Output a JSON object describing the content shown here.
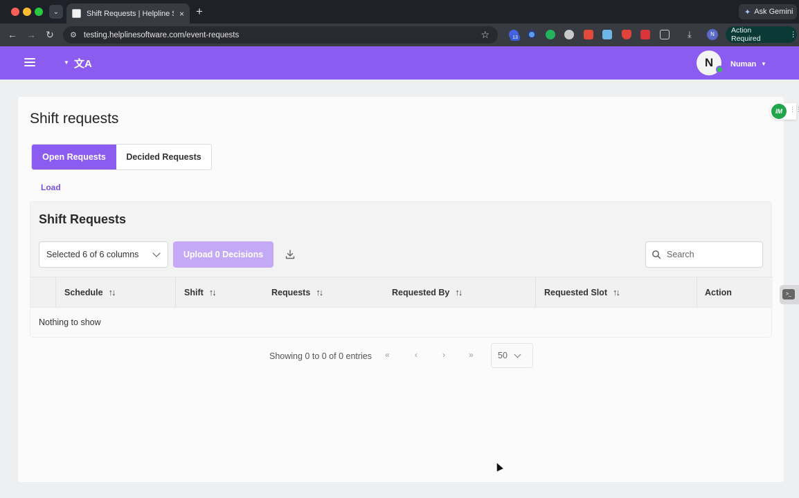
{
  "browser": {
    "tab_title": "Shift Requests | Helpline Soft",
    "tab_close": "×",
    "new_tab": "+",
    "url": "testing.helplinesoftware.com/event-requests",
    "ask_gemini": "Ask Gemini",
    "action_required": "Action Required",
    "extension_badge": "13",
    "profile_initial": "N"
  },
  "header": {
    "avatar_initial": "N",
    "user_name": "Numan",
    "brand_color": "#8c5bf0"
  },
  "page": {
    "title": "Shift requests",
    "tabs": [
      {
        "label": "Open Requests",
        "active": true
      },
      {
        "label": "Decided Requests",
        "active": false
      }
    ],
    "load_link": "Load"
  },
  "panel": {
    "title": "Shift Requests",
    "column_select": "Selected 6 of 6 columns",
    "upload_button": "Upload 0 Decisions",
    "search_placeholder": "Search",
    "columns": [
      {
        "label": "Schedule",
        "sortable": true
      },
      {
        "label": "Shift",
        "sortable": true
      },
      {
        "label": "Requests",
        "sortable": true
      },
      {
        "label": "Requested By",
        "sortable": true
      },
      {
        "label": "Requested Slot",
        "sortable": true
      },
      {
        "label": "Action",
        "sortable": false
      }
    ],
    "empty_text": "Nothing to show"
  },
  "pagination": {
    "info": "Showing 0 to 0 of 0 entries",
    "first": "«",
    "prev": "‹",
    "next": "›",
    "last": "»",
    "page_size": "50"
  },
  "widgets": {
    "im_label": "IM"
  }
}
